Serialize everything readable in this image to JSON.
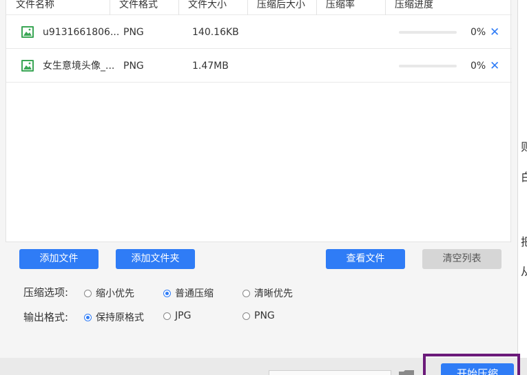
{
  "table": {
    "headers": [
      "文件名称",
      "文件格式",
      "文件大小",
      "压缩后大小",
      "压缩率",
      "压缩进度"
    ],
    "rows": [
      {
        "name": "u9131661806...",
        "format": "PNG",
        "size": "140.16KB",
        "compressed_size": "",
        "ratio": "",
        "progress_text": "0%",
        "progress": 0
      },
      {
        "name": "女生意境头像_...",
        "format": "PNG",
        "size": "1.47MB",
        "compressed_size": "",
        "ratio": "",
        "progress_text": "0%",
        "progress": 0
      }
    ],
    "remove_icon": "close-icon",
    "file_icon": "image-icon"
  },
  "actions": {
    "add_file": "添加文件",
    "add_folder": "添加文件夹",
    "view_file": "查看文件",
    "clear_list": "清空列表"
  },
  "options": {
    "compress_label": "压缩选项:",
    "compress": [
      {
        "label": "缩小优先",
        "selected": false
      },
      {
        "label": "普通压缩",
        "selected": true
      },
      {
        "label": "清晰优先",
        "selected": false
      }
    ],
    "format_label": "输出格式:",
    "format": [
      {
        "label": "保持原格式",
        "selected": true
      },
      {
        "label": "JPG",
        "selected": false
      },
      {
        "label": "PNG",
        "selected": false
      }
    ]
  },
  "bottom": {
    "start_button": "开始压缩",
    "folder_icon": "folder-icon"
  },
  "right_edge_chars": [
    "则",
    "白",
    "把",
    "从"
  ],
  "colors": {
    "accent": "#2f7cf6",
    "highlight_frame": "#6b1a7a",
    "file_icon": "#3aa655"
  }
}
